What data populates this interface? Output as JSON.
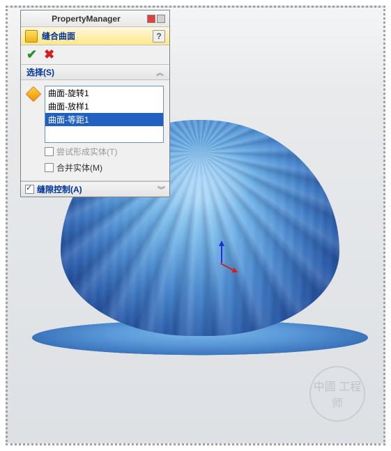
{
  "header": {
    "title": "PropertyManager"
  },
  "feature": {
    "title": "缝合曲面"
  },
  "sections": {
    "selection": {
      "title": "选择(S)",
      "items": [
        "曲面-旋转1",
        "曲面-放样1",
        "曲面-等距1"
      ],
      "selected_index": 2,
      "try_solid_label": "尝试形成实体(T)",
      "merge_label": "合并实体(M)"
    },
    "gap": {
      "title": "缝隙控制(A)"
    }
  },
  "watermark": "中國\n工程师"
}
